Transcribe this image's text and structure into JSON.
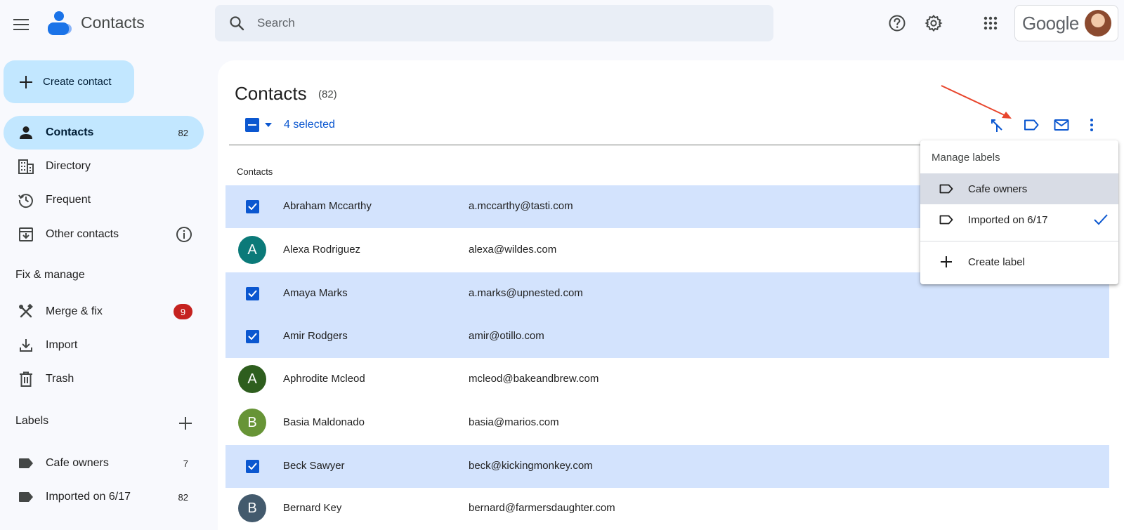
{
  "app": {
    "title": "Contacts"
  },
  "search": {
    "placeholder": "Search"
  },
  "account": {
    "brand": "Google"
  },
  "sidebar": {
    "create_label": "Create contact",
    "nav": [
      {
        "label": "Contacts",
        "count": "82",
        "icon": "person-icon",
        "active": true
      },
      {
        "label": "Directory",
        "icon": "building-icon"
      },
      {
        "label": "Frequent",
        "icon": "history-icon"
      },
      {
        "label": "Other contacts",
        "icon": "archive-icon"
      }
    ],
    "fix_heading": "Fix & manage",
    "fix": [
      {
        "label": "Merge & fix",
        "badge": "9",
        "icon": "merge-fix-icon"
      },
      {
        "label": "Import",
        "icon": "import-icon"
      },
      {
        "label": "Trash",
        "icon": "trash-icon"
      }
    ],
    "labels_heading": "Labels",
    "labels": [
      {
        "label": "Cafe owners",
        "count": "7"
      },
      {
        "label": "Imported on 6/17",
        "count": "82"
      }
    ]
  },
  "main": {
    "title": "Contacts",
    "count": "(82)",
    "selection_text": "4 selected",
    "column_header": "Contacts",
    "rows": [
      {
        "name": "Abraham Mccarthy",
        "email": "a.mccarthy@tasti.com",
        "selected": true,
        "initial": ""
      },
      {
        "name": "Alexa Rodriguez",
        "email": "alexa@wildes.com",
        "selected": false,
        "initial": "A",
        "color": "#0b7a79"
      },
      {
        "name": "Amaya Marks",
        "email": "a.marks@upnested.com",
        "selected": true,
        "initial": ""
      },
      {
        "name": "Amir Rodgers",
        "email": "amir@otillo.com",
        "selected": true,
        "initial": ""
      },
      {
        "name": "Aphrodite Mcleod",
        "email": "mcleod@bakeandbrew.com",
        "selected": false,
        "initial": "A",
        "color": "#2e5e1e"
      },
      {
        "name": "Basia Maldonado",
        "email": "basia@marios.com",
        "selected": false,
        "initial": "B",
        "color": "#679436"
      },
      {
        "name": "Beck Sawyer",
        "email": "beck@kickingmonkey.com",
        "selected": true,
        "initial": ""
      },
      {
        "name": "Bernard Key",
        "email": "bernard@farmersdaughter.com",
        "selected": false,
        "initial": "B",
        "color": "#435a6d"
      }
    ]
  },
  "dropdown": {
    "heading": "Manage labels",
    "items": [
      {
        "label": "Cafe owners",
        "checked": false
      },
      {
        "label": "Imported on 6/17",
        "checked": true
      }
    ],
    "create_label": "Create label"
  },
  "colors": {
    "accent": "#0b57d0",
    "selected_row": "#d3e3fd",
    "nav_active": "#c2e7ff",
    "badge": "#c5221f",
    "annotation_arrow": "#e8452c"
  }
}
